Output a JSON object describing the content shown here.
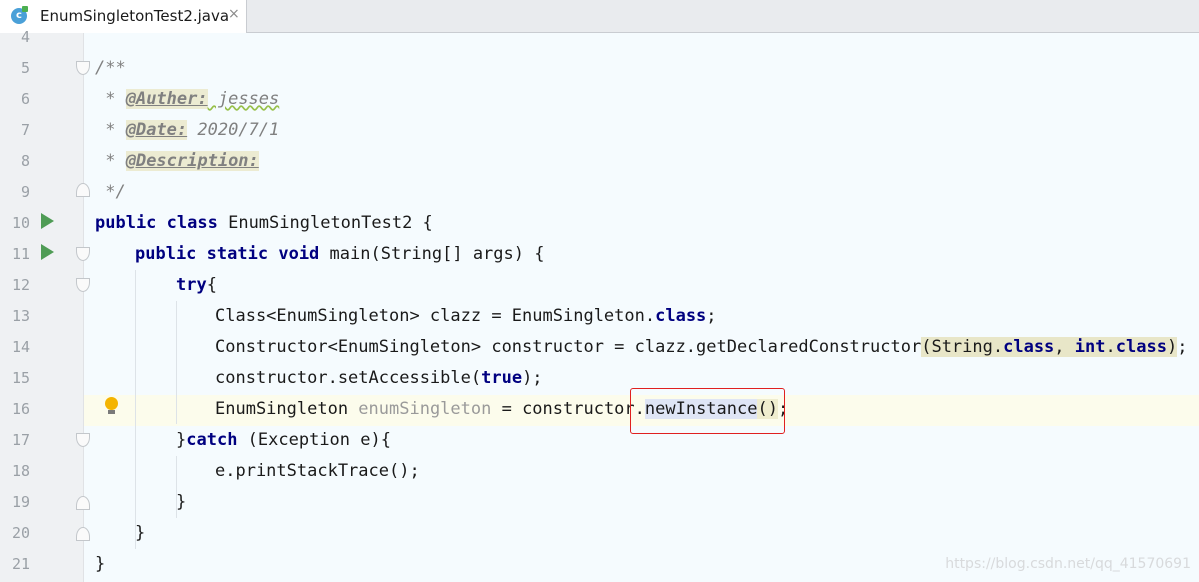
{
  "tab": {
    "icon": "c",
    "label": "EnumSingletonTest2.java",
    "close": "×"
  },
  "line_numbers": [
    "4",
    "5",
    "6",
    "7",
    "8",
    "9",
    "10",
    "11",
    "12",
    "13",
    "14",
    "15",
    "16",
    "17",
    "18",
    "19",
    "20",
    "21"
  ],
  "code": {
    "l5": "/**",
    "l6_prefix": " * ",
    "l6_tag": "@Auther:",
    "l6_text": " jesses",
    "l7_prefix": " * ",
    "l7_tag": "@Date:",
    "l7_text": " 2020/7/1",
    "l8_prefix": " * ",
    "l8_tag": "@Description:",
    "l9": " */",
    "l10_kw1": "public",
    "l10_kw2": "class",
    "l10_rest": " EnumSingletonTest2 {",
    "l11_kw1": "public",
    "l11_kw2": "static",
    "l11_kw3": "void",
    "l11_rest": " main(String[] args) {",
    "l12_kw": "try",
    "l12_rest": "{",
    "l13_a": "Class<EnumSingleton> clazz = EnumSingleton.",
    "l13_kw": "class",
    "l13_b": ";",
    "l14_a": "Constructor<EnumSingleton> constructor = clazz.getDeclaredConstructor",
    "l14_p1": "(String.",
    "l14_kw1": "class",
    "l14_p2": ", ",
    "l14_kw2": "int",
    "l14_p3": ".",
    "l14_kw3": "class",
    "l14_p4": ")",
    "l14_b": ";",
    "l15_a": "constructor.setAccessible(",
    "l15_kw": "true",
    "l15_b": ");",
    "l16_a": "EnumSingleton ",
    "l16_var": "enumSingleton",
    "l16_b": " = constructor.",
    "l16_call": "newInstance",
    "l16_paren": "()",
    "l16_c": ";",
    "l17_a": "}",
    "l17_kw": "catch",
    "l17_b": " (Exception e){",
    "l18": "e.printStackTrace();",
    "l19": "}",
    "l20": "}",
    "l21": "}"
  },
  "watermark": "https://blog.csdn.net/qq_41570691",
  "colors": {
    "keyword": "#000080",
    "comment": "#808080",
    "highlight_box": "#e02020",
    "run_icon": "#4f9c55",
    "bulb": "#f4b400"
  },
  "icons": [
    "java-class-icon",
    "close-icon",
    "run-icon",
    "fold-icon",
    "intention-bulb-icon"
  ]
}
